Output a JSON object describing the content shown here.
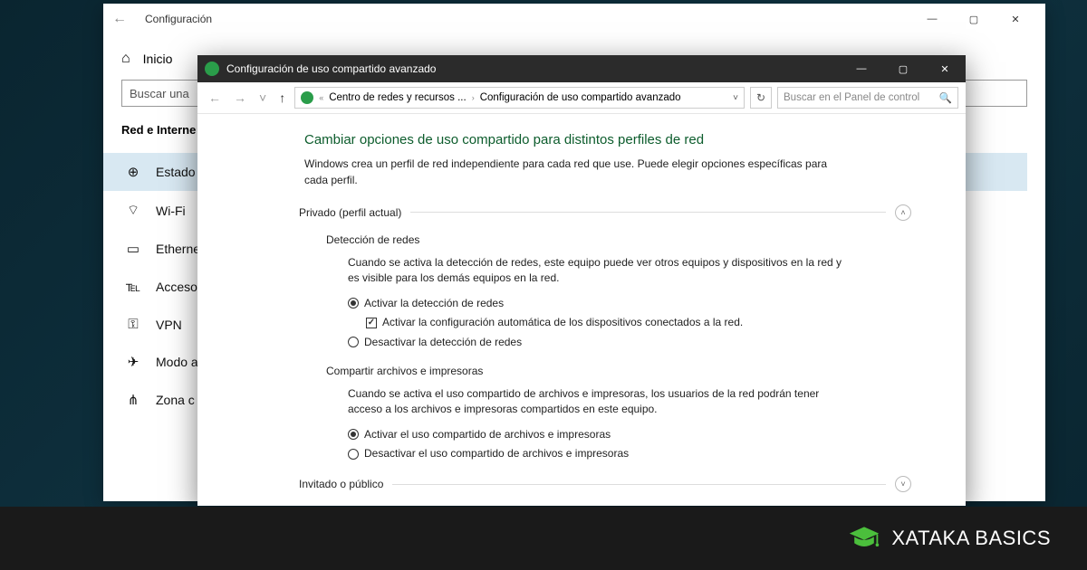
{
  "settings": {
    "title": "Configuración",
    "home": "Inicio",
    "search_placeholder": "Buscar una",
    "section": "Red e Interne",
    "nav": {
      "status": "Estado",
      "wifi": "Wi-Fi",
      "ethernet": "Etherne",
      "dialup": "Acceso",
      "vpn": "VPN",
      "airplane": "Modo a",
      "hotspot": "Zona c"
    }
  },
  "sharing": {
    "title": "Configuración de uso compartido avanzado",
    "breadcrumb": {
      "part1": "Centro de redes y recursos ...",
      "part2": "Configuración de uso compartido avanzado"
    },
    "search_placeholder": "Buscar en el Panel de control",
    "heading": "Cambiar opciones de uso compartido para distintos perfiles de red",
    "subtitle": "Windows crea un perfil de red independiente para cada red que use. Puede elegir opciones específicas para cada perfil.",
    "profile_private": "Privado (perfil actual)",
    "profile_guest": "Invitado o público",
    "discovery": {
      "title": "Detección de redes",
      "desc": "Cuando se activa la detección de redes, este equipo puede ver otros equipos y dispositivos en la red y es visible para los demás equipos en la red.",
      "on": "Activar la detección de redes",
      "auto": "Activar la configuración automática de los dispositivos conectados a la red.",
      "off": "Desactivar la detección de redes"
    },
    "fileshare": {
      "title": "Compartir archivos e impresoras",
      "desc": "Cuando se activa el uso compartido de archivos e impresoras, los usuarios de la red podrán tener acceso a los archivos e impresoras compartidos en este equipo.",
      "on": "Activar el uso compartido de archivos e impresoras",
      "off": "Desactivar el uso compartido de archivos e impresoras"
    }
  },
  "brand": {
    "text": "XATAKA BASICS"
  }
}
